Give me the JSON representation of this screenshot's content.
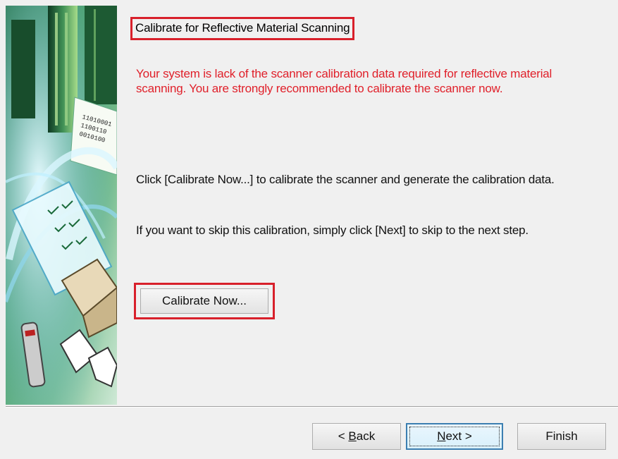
{
  "heading": "Calibrate for Reflective Material Scanning",
  "warning": "Your system is lack of the scanner calibration data required for reflective material scanning.  You are strongly recommended to calibrate the scanner now.",
  "instructions": [
    "Click [Calibrate Now...] to calibrate the scanner and generate the calibration data.",
    "If you want to skip this calibration, simply click [Next] to skip to the next step."
  ],
  "calibrate_button": "Calibrate Now...",
  "footer": {
    "back_prefix": "< ",
    "back_mnemonic": "B",
    "back_rest": "ack",
    "next_mnemonic": "N",
    "next_rest": "ext >",
    "finish_label": "Finish"
  },
  "colors": {
    "warning_text": "#e0202a",
    "highlight_border": "#d8202b",
    "dialog_bg": "#f0f0f0"
  },
  "icons": {
    "side_image": "scanner-wizard-banner-image"
  }
}
